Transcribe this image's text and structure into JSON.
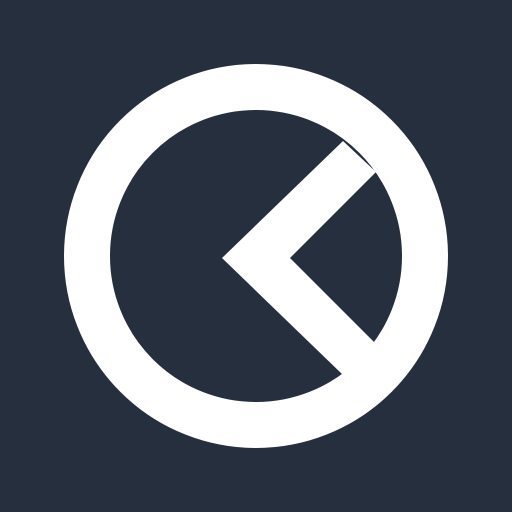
{
  "app": {
    "icon_name": "circle-chevron-logo-icon"
  },
  "colors": {
    "background": "#252F3E",
    "foreground": "#FFFFFF"
  }
}
